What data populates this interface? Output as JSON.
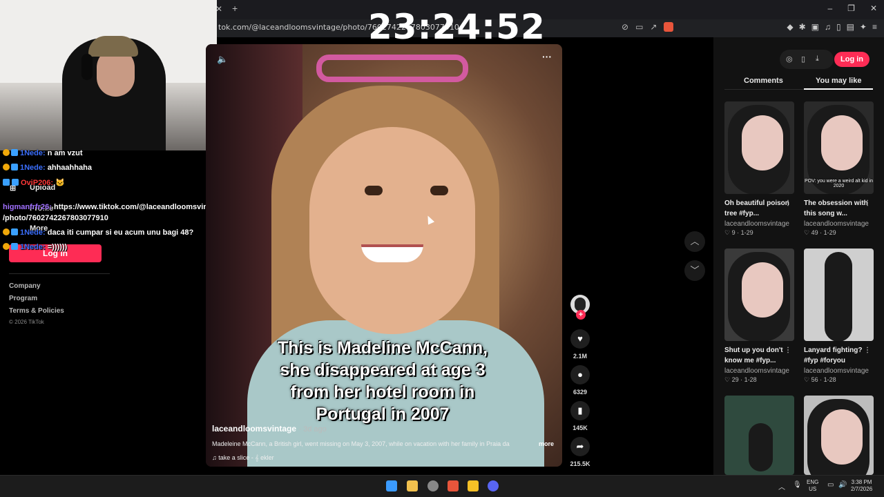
{
  "stream": {
    "clock": "23:24:52"
  },
  "browser": {
    "url": "tok.com/@laceandloomsvintage/photo/7602742267803077910",
    "window_controls": [
      "–",
      "❐",
      "✕"
    ]
  },
  "sidebar": {
    "upload": "Upload",
    "profile": "Profile",
    "more": "More",
    "login": "Log in",
    "footer": [
      "Company",
      "Program",
      "Terms & Policies"
    ],
    "copyright": "© 2026 TikTok"
  },
  "chat": [
    {
      "user": "1Nede:",
      "message": "n am vzut"
    },
    {
      "user": "1Nede:",
      "message": "ahhaahhaha"
    },
    {
      "user": "OviP206:",
      "message": "🐱"
    },
    {
      "user": "higmanfrfr26:",
      "message": "https://www.tiktok.com/@laceandloomsvintage"
    },
    {
      "user": "",
      "message": "/photo/7602742267803077910"
    },
    {
      "user": "1Nede:",
      "message": "daca iti cumpar si eu acum unu bagi 48?"
    },
    {
      "user": "1Nede:",
      "message": "=))))))"
    }
  ],
  "video": {
    "caption": "This is Madeline McCann, she disappeared at age 3 from her hotel room in Portugal in 2007",
    "author": "laceandloomsvintage",
    "age": "· 3d ago",
    "description": "Madeleine McCann, a British girl, went missing on May 3, 2007, while on vacation with her family in Praia da",
    "more": "more",
    "music": "♫  take a slice - 𝄞 ekler"
  },
  "actions": {
    "likes": "2.1M",
    "comments": "6329",
    "saves": "145K",
    "shares": "215.5K"
  },
  "panel": {
    "login": "Log in",
    "tabs": [
      "Comments",
      "You may like"
    ],
    "active_tab": "You may like",
    "cards": [
      {
        "title": "Oh beautiful poison tree #fyp...",
        "author": "laceandloomsvintage",
        "likes": "9",
        "date": "1-29",
        "overlay": ""
      },
      {
        "title": "The obsession with this song w...",
        "author": "laceandloomsvintage",
        "likes": "49",
        "date": "1-29",
        "overlay": "POV: you were a weird alt kid in 2020"
      },
      {
        "title": "Shut up you don't know me #fyp...",
        "author": "laceandloomsvintage",
        "likes": "29",
        "date": "1-28",
        "overlay": ""
      },
      {
        "title": "Lanyard fighting? #fyp #foryou",
        "author": "laceandloomsvintage",
        "likes": "56",
        "date": "1-28",
        "overlay": ""
      },
      {
        "title": "",
        "author": "",
        "likes": "",
        "date": "",
        "overlay": ""
      },
      {
        "title": "",
        "author": "",
        "likes": "",
        "date": "",
        "overlay": ""
      }
    ]
  },
  "taskbar": {
    "lang": "ENG",
    "region": "US",
    "time": "3:38 PM",
    "date": "2/7/2026"
  },
  "colors": {
    "accent": "#fe2c55",
    "background": "#000000",
    "panel": "#121212"
  }
}
